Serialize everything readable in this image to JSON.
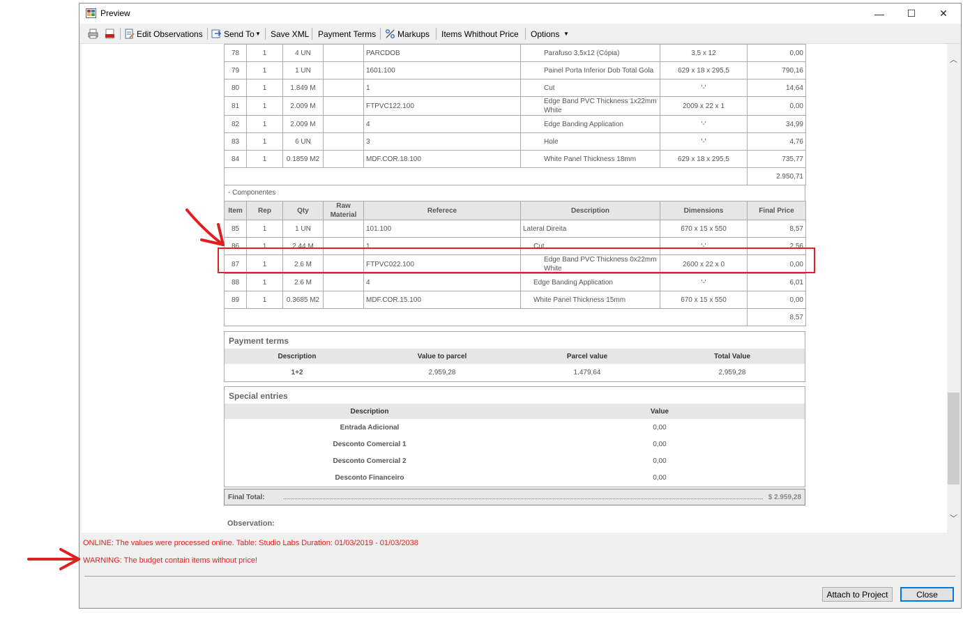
{
  "window": {
    "title": "Preview"
  },
  "titlebar": {
    "minimize": "—",
    "maximize": "☐",
    "close": "✕"
  },
  "toolbar": {
    "edit_observations": "Edit Observations",
    "send_to": "Send To",
    "save_xml": "Save XML",
    "payment_terms": "Payment Terms",
    "markups": "Markups",
    "items_without_price": "Items Whithout Price",
    "options": "Options"
  },
  "top_rows": [
    {
      "item": "78",
      "rep": "1",
      "qty": "4 UN",
      "ref": "PARCDOB",
      "desc": "Parafuso 3,5x12 (Cópia)",
      "dim": "3,5 x 12",
      "price": "0,00"
    },
    {
      "item": "79",
      "rep": "1",
      "qty": "1 UN",
      "ref": "1601.100",
      "desc": "Painel Porta Inferior Dob Total Gola",
      "dim": "629 x 18 x 295,5",
      "price": "790,16"
    },
    {
      "item": "80",
      "rep": "1",
      "qty": "1.849 M",
      "ref": "1",
      "desc": "Cut",
      "dim": "'-'",
      "price": "14,64"
    },
    {
      "item": "81",
      "rep": "1",
      "qty": "2.009 M",
      "ref": "FTPVC122.100",
      "desc": "Edge Band PVC Thickness 1x22mm White",
      "dim": "2009 x 22 x 1",
      "price": "0,00"
    },
    {
      "item": "82",
      "rep": "1",
      "qty": "2.009 M",
      "ref": "4",
      "desc": "Edge Banding Application",
      "dim": "'-'",
      "price": "34,99"
    },
    {
      "item": "83",
      "rep": "1",
      "qty": "6 UN",
      "ref": "3",
      "desc": "Hole",
      "dim": "'-'",
      "price": "4,76"
    },
    {
      "item": "84",
      "rep": "1",
      "qty": "0.1859 M2",
      "ref": "MDF.COR.18.100",
      "desc": "White Panel Thickness 18mm",
      "dim": "629 x 18 x 295,5",
      "price": "735,77"
    }
  ],
  "top_subtotal": "2.950,71",
  "components_label": "- Componentes",
  "headers": {
    "item": "Item",
    "rep": "Rep",
    "qty": "Qty",
    "raw": "Raw Material",
    "ref": "Referece",
    "desc": "Description",
    "dim": "Dimensions",
    "price": "Final Price"
  },
  "comp_rows": [
    {
      "item": "85",
      "rep": "1",
      "qty": "1 UN",
      "ref": "101.100",
      "desc": "Lateral Direita",
      "dim": "670 x 15 x 550",
      "price": "8,57"
    },
    {
      "item": "86",
      "rep": "1",
      "qty": "2.44 M",
      "ref": "1",
      "desc": "Cut",
      "dim": "'-'",
      "price": "2,56"
    },
    {
      "item": "87",
      "rep": "1",
      "qty": "2.6 M",
      "ref": "FTPVC022.100",
      "desc": "Edge Band PVC Thickness 0x22mm White",
      "dim": "2600 x 22 x 0",
      "price": "0,00"
    },
    {
      "item": "88",
      "rep": "1",
      "qty": "2.6 M",
      "ref": "4",
      "desc": "Edge Banding Application",
      "dim": "'-'",
      "price": "6,01"
    },
    {
      "item": "89",
      "rep": "1",
      "qty": "0.3685 M2",
      "ref": "MDF.COR.15.100",
      "desc": "White Panel Thickness 15mm",
      "dim": "670 x 15 x 550",
      "price": "0,00"
    }
  ],
  "comp_subtotal": "8,57",
  "payment_terms": {
    "title": "Payment terms",
    "headers": [
      "Description",
      "Value to parcel",
      "Parcel value",
      "Total Value"
    ],
    "row": [
      "1+2",
      "2.959,28",
      "1.479,64",
      "2.959,28"
    ]
  },
  "special_entries": {
    "title": "Special entries",
    "headers": [
      "Description",
      "Value"
    ],
    "rows": [
      [
        "Entrada Adicional",
        "0,00"
      ],
      [
        "Desconto Comercial 1",
        "0,00"
      ],
      [
        "Desconto Comercial 2",
        "0,00"
      ],
      [
        "Desconto Financeiro",
        "0,00"
      ]
    ]
  },
  "final_total": {
    "label": "Final Total:",
    "value": "$ 2.959,28"
  },
  "observation_label": "Observation:",
  "messages": {
    "online": "ONLINE: The values were processed online. Table: Studio Labs Duration: 01/03/2019 - 01/03/2038",
    "warning": "WARNING: The budget contain items without price!"
  },
  "buttons": {
    "attach": "Attach to Project",
    "close": "Close"
  },
  "colors": {
    "annotation_red": "#e0201f",
    "primary_border": "#0078d7"
  }
}
